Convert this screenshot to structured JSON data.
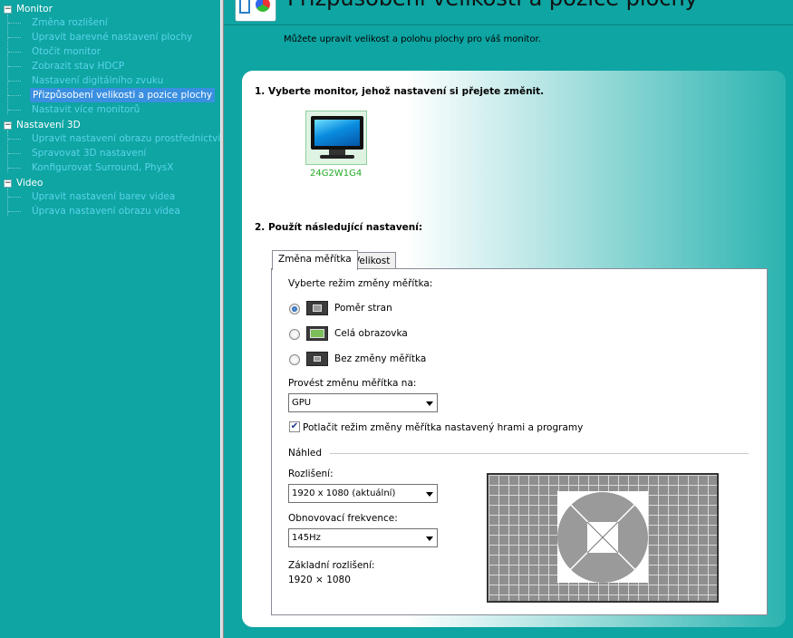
{
  "sidebar": {
    "categories": [
      {
        "label": "Monitor",
        "toggle": "−"
      },
      {
        "label": "Nastavení 3D",
        "toggle": "−"
      },
      {
        "label": "Video",
        "toggle": "−"
      }
    ],
    "monitor_items": [
      "Změna rozlišení",
      "Upravit barevné nastavení plochy",
      "Otočit monitor",
      "Zobrazit stav HDCP",
      "Nastavení digitálního zvuku",
      "Přizpůsobení velikosti a pozice plochy",
      "Nastavit více monitorů"
    ],
    "3d_items": [
      "Upravit nastavení obrazu prostřednictvím n",
      "Spravovat 3D nastavení",
      "Konfigurovat Surround, PhysX"
    ],
    "video_items": [
      "Upravit nastavení barev videa",
      "Úprava nastavení obrazu videa"
    ]
  },
  "header": {
    "title": "Přizpůsobení velikosti a pozice plochy",
    "subtitle": "Můžete upravit velikost a polohu plochy pro váš monitor."
  },
  "step1": {
    "label": "1. Vyberte monitor, jehož nastavení si přejete změnit.",
    "monitor_name": "24G2W1G4"
  },
  "step2": {
    "label": "2. Použít následující nastavení:",
    "tabs": [
      "Změna měřítka",
      "Velikost"
    ]
  },
  "scaling": {
    "mode_label": "Vyberte režim změny měřítka:",
    "modes": [
      "Poměr stran",
      "Celá obrazovka",
      "Bez změny měřítka"
    ],
    "selected_mode": "Poměr stran",
    "perform_on_label": "Provést změnu měřítka na:",
    "perform_on_value": "GPU",
    "override_label": "Potlačit režim změny měřítka nastavený hrami a programy",
    "override_checked": "✔",
    "preview_label": "Náhled",
    "resolution_label": "Rozlišení:",
    "resolution_value": "1920 x 1080 (aktuální)",
    "refresh_label": "Obnovovací frekvence:",
    "refresh_value": "145Hz",
    "native_label": "Základní rozlišení:",
    "native_value": "1920 × 1080"
  }
}
